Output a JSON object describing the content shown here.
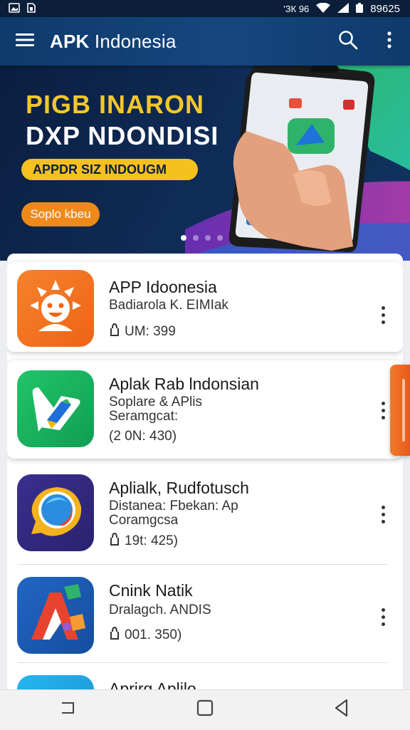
{
  "status_bar": {
    "right_text": "89625",
    "signal_text": "'ЗК 96"
  },
  "app_bar": {
    "title_bold": "APK",
    "title_rest": " Indonesia"
  },
  "banner": {
    "headline_1": "PIGB INARON",
    "headline_2": "DXP NDONDISI",
    "strip_text": "APPDR SIZ INDOUGM",
    "cta_label": "Soplo kbeu",
    "slide_count": 4,
    "active_slide": 1
  },
  "apps": [
    {
      "name": "APP Idoonesia",
      "sub1": "Badiarola K. EIMIak",
      "sub2": "",
      "meta": "UM: 399"
    },
    {
      "name": "Aplak Rab lndonsian",
      "sub1": "Soplare & APlis",
      "sub2": "Seramgcat:",
      "meta": "(2 0N: 430)"
    },
    {
      "name": "Aplialk, Rudfotusch",
      "sub1": "Distanea: Fbekan: Ap",
      "sub2": "Coramgcsa",
      "meta": "19t: 425)"
    },
    {
      "name": "Cnink Natik",
      "sub1": "Dralagch. ANDIS",
      "sub2": "",
      "meta": "001. 350)"
    },
    {
      "name": "Aprirg Aplilo",
      "sub1": "",
      "sub2": "",
      "meta": ""
    }
  ],
  "colors": {
    "app_bar": "#15467e",
    "accent_orange": "#ef8a1a",
    "banner_yellow": "#f3c72a"
  },
  "icons": [
    "menu-icon",
    "search-icon",
    "more-vert-icon",
    "download-icon",
    "recent-apps-icon",
    "home-icon",
    "back-icon"
  ]
}
